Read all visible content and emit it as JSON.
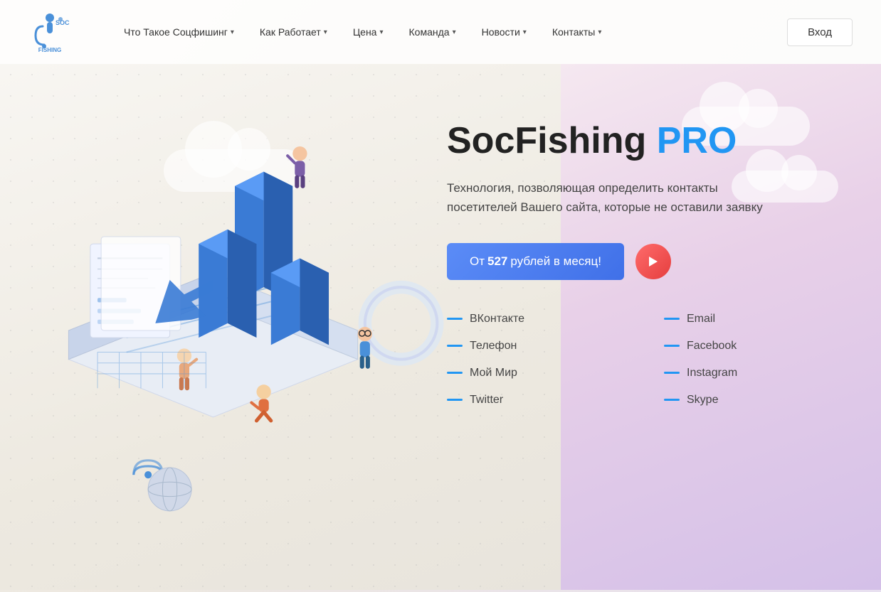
{
  "nav": {
    "logo_text": "SocFishing",
    "items": [
      {
        "label": "Что Такое Соцфишинг",
        "has_dropdown": true
      },
      {
        "label": "Как Работает",
        "has_dropdown": true
      },
      {
        "label": "Цена",
        "has_dropdown": true
      },
      {
        "label": "Команда",
        "has_dropdown": true
      },
      {
        "label": "Новости",
        "has_dropdown": true
      },
      {
        "label": "Контакты",
        "has_dropdown": true
      }
    ],
    "login_label": "Вход"
  },
  "hero": {
    "title_main": "SocFishing ",
    "title_pro": "PRO",
    "subtitle": "Технология, позволяющая определить контакты посетителей Вашего сайта, которые не оставили заявку",
    "cta_prefix": "От ",
    "cta_price": "527",
    "cta_suffix": " рублей в месяц!",
    "features": [
      {
        "label": "ВКонтакте",
        "col": 1
      },
      {
        "label": "Email",
        "col": 2
      },
      {
        "label": "Телефон",
        "col": 1
      },
      {
        "label": "Facebook",
        "col": 2
      },
      {
        "label": "Мой Мир",
        "col": 1
      },
      {
        "label": "Instagram",
        "col": 2
      },
      {
        "label": "Twitter",
        "col": 1
      },
      {
        "label": "Skype",
        "col": 2
      }
    ]
  },
  "colors": {
    "accent_blue": "#2196F3",
    "accent_red": "#e53e3e",
    "dash_color": "#2196F3"
  }
}
